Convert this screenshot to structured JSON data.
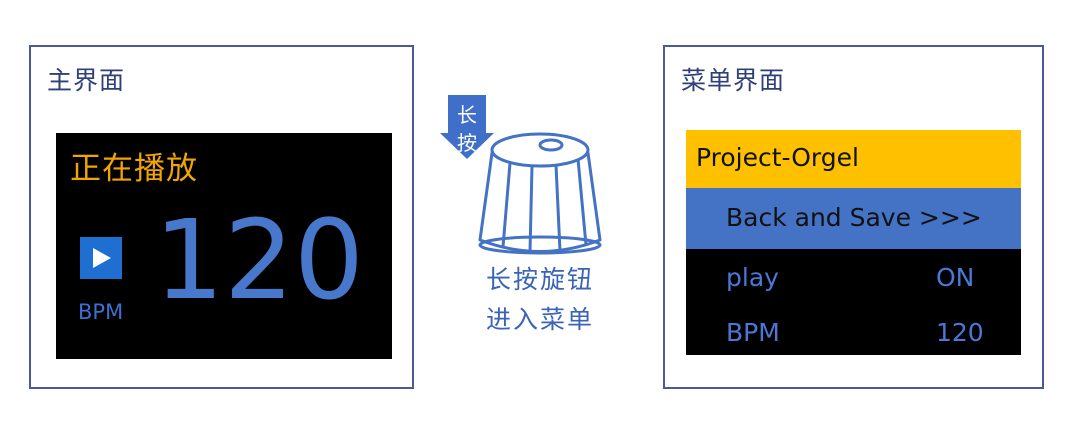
{
  "main_panel": {
    "title": "主界面",
    "status": "正在播放",
    "bpm_label": "BPM",
    "bpm_value": "120"
  },
  "knob": {
    "arrow_label_1": "长",
    "arrow_label_2": "按",
    "caption_line_1": "长按旋钮",
    "caption_line_2": "进入菜单"
  },
  "menu_panel": {
    "title": "菜单界面",
    "header": "Project-Orgel",
    "selected_item": "Back and Save >>>",
    "rows": [
      {
        "label": "play",
        "value": "ON"
      },
      {
        "label": "BPM",
        "value": "120"
      }
    ]
  },
  "colors": {
    "panel_border": "#4a5a9a",
    "status_orange": "#f0a500",
    "play_blue": "#1f6fd1",
    "bpm_blue": "#4878cc",
    "menu_header_yellow": "#ffc000",
    "menu_selected_blue": "#4472c4",
    "knob_stroke": "#4472c4"
  },
  "icons": {
    "play": "play-icon",
    "knob": "rotary-knob-icon",
    "arrow": "down-arrow-icon"
  }
}
